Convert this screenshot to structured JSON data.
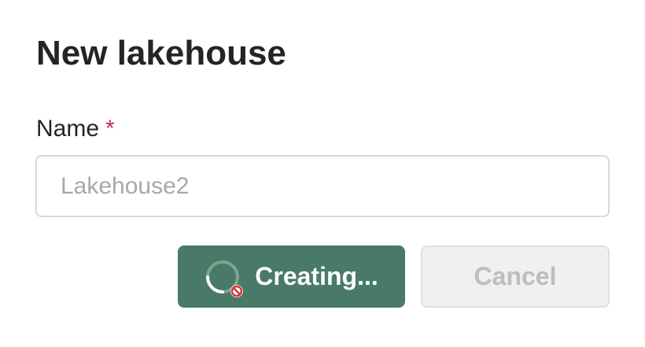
{
  "dialog": {
    "title": "New lakehouse",
    "name_label": "Name",
    "required_marker": "*",
    "name_placeholder": "Lakehouse2",
    "name_value": "",
    "create_button_label": "Creating...",
    "cancel_button_label": "Cancel"
  },
  "icons": {
    "spinner": "loading-spinner-icon",
    "cursor": "not-allowed-cursor-icon"
  },
  "colors": {
    "primary_button": "#487a67",
    "required_asterisk": "#c4314b",
    "disabled_text": "#bdbdbd"
  }
}
